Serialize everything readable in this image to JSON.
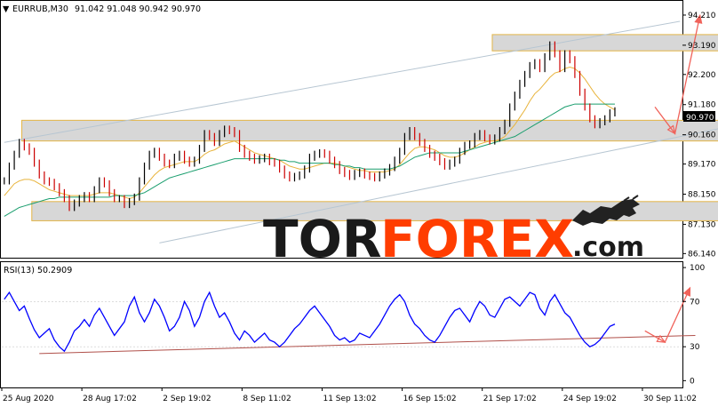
{
  "header": {
    "symbol": "EURRUB,M30",
    "ohlc": "91.042 91.048 90.942 90.970"
  },
  "rsi_label": "RSI(13) 50.2909",
  "price_badge": "90.970",
  "watermark": {
    "part1": "TOR",
    "part2": "FOREX",
    "part3": ".com"
  },
  "colors": {
    "price_up": "#000000",
    "price_down": "#cc0000",
    "ma_fast": "#e8b33a",
    "ma_slow": "#1a9e6e",
    "channel": "#b7c6d2",
    "zone_fill": "#d7d7d7",
    "zone_border": "#e3b547",
    "forecast": "#f0625a",
    "rsi_line": "#0000ff",
    "rsi_trend": "#b0504a",
    "frame": "#000000",
    "brand_orange": "#ff3d00"
  },
  "chart_data": {
    "type": "line",
    "price_axis": {
      "ticks": [
        "94.210",
        "93.190",
        "92.200",
        "91.180",
        "90.160",
        "89.170",
        "88.150",
        "87.130",
        "86.140"
      ],
      "tick_values": [
        94.21,
        93.19,
        92.2,
        91.18,
        90.16,
        89.17,
        88.15,
        87.13,
        86.14
      ],
      "ylim": [
        86.0,
        94.6
      ]
    },
    "rsi_axis": {
      "ticks": [
        "100",
        "70",
        "30",
        "0"
      ],
      "tick_values": [
        100,
        70,
        30,
        0
      ],
      "ylim": [
        -6,
        104
      ]
    },
    "x_axis": {
      "labels": [
        "25 Aug 2020",
        "28 Aug 17:02",
        "2 Sep 19:02",
        "8 Sep 11:02",
        "11 Sep 13:02",
        "16 Sep 15:02",
        "21 Sep 17:02",
        "24 Sep 19:02",
        "30 Sep 11:02"
      ],
      "label_index": [
        0,
        16,
        32,
        48,
        64,
        80,
        96,
        112,
        128
      ],
      "total_bars": 136
    },
    "series": [
      {
        "role": "price",
        "values": [
          88.6,
          89.1,
          89.5,
          89.9,
          89.75,
          89.6,
          89.2,
          88.8,
          88.6,
          88.55,
          88.4,
          88.2,
          88.0,
          87.7,
          87.85,
          88.0,
          88.1,
          88.0,
          88.3,
          88.6,
          88.5,
          88.2,
          88.0,
          88.0,
          87.8,
          87.9,
          88.05,
          88.6,
          89.1,
          89.5,
          89.6,
          89.4,
          89.2,
          89.15,
          89.4,
          89.5,
          89.3,
          89.2,
          89.3,
          89.7,
          90.2,
          90.1,
          89.9,
          90.2,
          90.35,
          90.3,
          90.2,
          89.7,
          89.5,
          89.4,
          89.3,
          89.35,
          89.4,
          89.25,
          89.2,
          89.0,
          88.8,
          88.7,
          88.75,
          88.8,
          89.0,
          89.4,
          89.5,
          89.55,
          89.5,
          89.3,
          89.15,
          88.95,
          88.85,
          88.75,
          88.85,
          88.9,
          88.8,
          88.75,
          88.7,
          88.8,
          88.9,
          89.05,
          89.3,
          89.6,
          90.1,
          90.3,
          90.1,
          89.9,
          89.7,
          89.5,
          89.4,
          89.25,
          89.1,
          89.2,
          89.3,
          89.6,
          89.8,
          89.85,
          90.1,
          90.2,
          90.05,
          89.95,
          90.05,
          90.3,
          90.55,
          91.1,
          91.5,
          91.9,
          92.2,
          92.5,
          92.6,
          92.4,
          92.8,
          93.2,
          92.9,
          92.4,
          92.9,
          92.7,
          92.2,
          91.6,
          91.1,
          90.7,
          90.5,
          90.6,
          90.7,
          90.9,
          90.97
        ],
        "x_start": 0
      },
      {
        "role": "ma_fast",
        "values": [
          88.1,
          88.3,
          88.5,
          88.6,
          88.65,
          88.65,
          88.6,
          88.5,
          88.4,
          88.3,
          88.25,
          88.2,
          88.15,
          88.1,
          88.1,
          88.1,
          88.1,
          88.1,
          88.15,
          88.2,
          88.2,
          88.2,
          88.15,
          88.1,
          88.05,
          88.0,
          88.05,
          88.2,
          88.4,
          88.6,
          88.8,
          88.95,
          89.05,
          89.1,
          89.15,
          89.2,
          89.25,
          89.25,
          89.25,
          89.35,
          89.5,
          89.6,
          89.65,
          89.75,
          89.85,
          89.9,
          89.95,
          89.85,
          89.75,
          89.65,
          89.55,
          89.5,
          89.45,
          89.4,
          89.35,
          89.3,
          89.2,
          89.1,
          89.05,
          89.0,
          89.0,
          89.05,
          89.1,
          89.15,
          89.2,
          89.2,
          89.2,
          89.15,
          89.1,
          89.05,
          89.0,
          88.95,
          88.95,
          88.9,
          88.9,
          88.9,
          88.9,
          88.95,
          89.0,
          89.15,
          89.35,
          89.55,
          89.7,
          89.75,
          89.75,
          89.7,
          89.65,
          89.55,
          89.45,
          89.4,
          89.4,
          89.45,
          89.55,
          89.65,
          89.75,
          89.85,
          89.9,
          89.95,
          89.95,
          90.0,
          90.1,
          90.3,
          90.5,
          90.75,
          91.0,
          91.3,
          91.55,
          91.7,
          91.9,
          92.1,
          92.25,
          92.3,
          92.4,
          92.45,
          92.4,
          92.25,
          92.05,
          91.8,
          91.55,
          91.35,
          91.2,
          91.1,
          91.0
        ],
        "x_start": 0
      },
      {
        "role": "ma_slow",
        "values": [
          87.4,
          87.5,
          87.6,
          87.7,
          87.75,
          87.8,
          87.85,
          87.9,
          87.95,
          88.0,
          88.0,
          88.05,
          88.05,
          88.05,
          88.05,
          88.05,
          88.05,
          88.05,
          88.05,
          88.05,
          88.05,
          88.05,
          88.1,
          88.1,
          88.1,
          88.1,
          88.1,
          88.15,
          88.2,
          88.3,
          88.4,
          88.5,
          88.6,
          88.7,
          88.75,
          88.8,
          88.85,
          88.9,
          88.95,
          89.0,
          89.05,
          89.1,
          89.15,
          89.2,
          89.25,
          89.3,
          89.35,
          89.35,
          89.35,
          89.35,
          89.35,
          89.35,
          89.35,
          89.35,
          89.35,
          89.3,
          89.3,
          89.25,
          89.25,
          89.2,
          89.2,
          89.2,
          89.2,
          89.2,
          89.2,
          89.2,
          89.15,
          89.15,
          89.1,
          89.1,
          89.05,
          89.05,
          89.0,
          89.0,
          89.0,
          89.0,
          89.0,
          89.0,
          89.05,
          89.1,
          89.2,
          89.3,
          89.4,
          89.45,
          89.5,
          89.55,
          89.55,
          89.55,
          89.55,
          89.55,
          89.55,
          89.55,
          89.6,
          89.65,
          89.7,
          89.75,
          89.8,
          89.85,
          89.9,
          89.95,
          90.0,
          90.05,
          90.1,
          90.2,
          90.3,
          90.4,
          90.5,
          90.6,
          90.7,
          90.8,
          90.9,
          91.0,
          91.1,
          91.15,
          91.2,
          91.2,
          91.2,
          91.2,
          91.2,
          91.2,
          91.2,
          91.2,
          91.2
        ],
        "x_start": 0
      },
      {
        "role": "rsi",
        "values": [
          72,
          78,
          70,
          62,
          66,
          55,
          45,
          38,
          42,
          46,
          36,
          30,
          26,
          34,
          44,
          48,
          54,
          48,
          58,
          64,
          56,
          48,
          40,
          46,
          52,
          66,
          74,
          60,
          52,
          60,
          72,
          66,
          56,
          44,
          48,
          56,
          70,
          62,
          48,
          56,
          70,
          78,
          66,
          56,
          60,
          52,
          42,
          36,
          44,
          40,
          34,
          38,
          42,
          36,
          34,
          30,
          34,
          40,
          46,
          50,
          56,
          62,
          66,
          60,
          54,
          48,
          40,
          36,
          38,
          34,
          36,
          42,
          40,
          38,
          44,
          50,
          58,
          66,
          72,
          76,
          70,
          58,
          50,
          46,
          40,
          36,
          34,
          40,
          48,
          56,
          62,
          64,
          58,
          52,
          62,
          70,
          66,
          58,
          56,
          64,
          72,
          74,
          70,
          66,
          72,
          78,
          76,
          64,
          58,
          70,
          76,
          68,
          60,
          56,
          48,
          40,
          34,
          30,
          32,
          36,
          42,
          48,
          50
        ],
        "x_start": 0
      },
      {
        "role": "forecast_price",
        "points": [
          [
            130,
            91.1
          ],
          [
            134,
            90.2
          ],
          [
            139,
            94.2
          ]
        ]
      },
      {
        "role": "forecast_rsi",
        "points": [
          [
            128,
            44
          ],
          [
            132,
            34
          ],
          [
            137,
            82
          ]
        ]
      },
      {
        "role": "channel_upper",
        "points": [
          [
            0,
            89.9
          ],
          [
            135,
            94.0
          ]
        ]
      },
      {
        "role": "channel_lower",
        "points": [
          [
            31,
            86.5
          ],
          [
            177,
            91.55
          ]
        ]
      },
      {
        "role": "rsi_trendline",
        "points": [
          [
            7,
            24
          ],
          [
            149,
            40
          ]
        ]
      },
      {
        "role": "zone_top",
        "x_range": [
          98,
          175
        ],
        "y_range": [
          93.0,
          93.55
        ]
      },
      {
        "role": "zone_mid",
        "x_range": [
          4,
          175
        ],
        "y_range": [
          89.95,
          90.65
        ]
      },
      {
        "role": "zone_bottom",
        "x_range": [
          6,
          175
        ],
        "y_range": [
          87.25,
          87.9
        ]
      }
    ],
    "grid": false,
    "legend": "none"
  }
}
